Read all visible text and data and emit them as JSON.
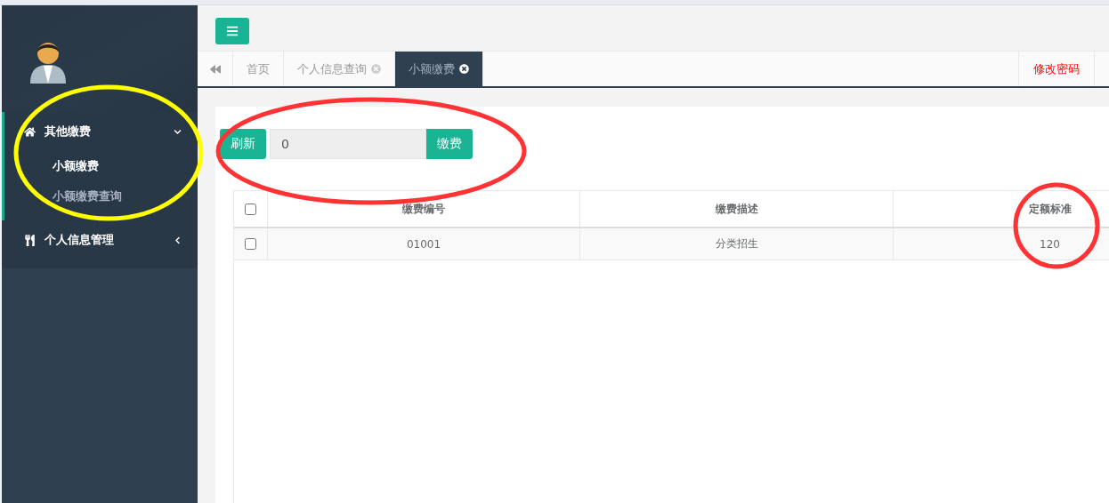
{
  "sidebar": {
    "menu": [
      {
        "label": "其他缴费",
        "kind": "home",
        "expanded": true,
        "children": [
          {
            "label": "小额缴费",
            "selected": true
          },
          {
            "label": "小额缴费查询",
            "selected": false
          }
        ]
      },
      {
        "label": "个人信息管理",
        "kind": "cutlery",
        "expanded": false
      }
    ]
  },
  "tabs": [
    {
      "label": "首页",
      "selected": false,
      "closable": false
    },
    {
      "label": "个人信息查询",
      "selected": false,
      "closable": true
    },
    {
      "label": "小额缴费",
      "selected": true,
      "closable": true
    }
  ],
  "header_link": "修改密码",
  "action_bar": {
    "refresh_button": "刷新",
    "amount_field": {
      "value": "0"
    },
    "pay_button": "缴费"
  },
  "table": {
    "header_checked": false,
    "columns": [
      "缴费编号",
      "缴费描述",
      "定额标准"
    ],
    "rows": [
      {
        "checked": false,
        "cells": [
          "01001",
          "分类招生",
          "120"
        ]
      }
    ]
  },
  "annotations": [
    {
      "kind": "ellipse",
      "color": "#ffff00"
    },
    {
      "kind": "ellipse",
      "color": "#ff3333"
    },
    {
      "kind": "ellipse",
      "color": "#ff3333"
    }
  ]
}
